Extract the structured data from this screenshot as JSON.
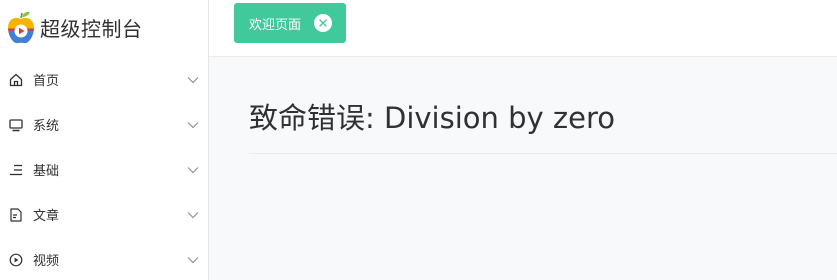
{
  "brand": {
    "title": "超级控制台",
    "logo": "apple-play-logo"
  },
  "sidebar": {
    "items": [
      {
        "label": "首页",
        "icon": "home-icon"
      },
      {
        "label": "系统",
        "icon": "monitor-icon"
      },
      {
        "label": "基础",
        "icon": "list-icon"
      },
      {
        "label": "文章",
        "icon": "document-icon"
      },
      {
        "label": "视频",
        "icon": "play-circle-icon"
      }
    ]
  },
  "tabs": [
    {
      "label": "欢迎页面",
      "active": true,
      "close_icon": "close-circle-icon"
    }
  ],
  "content": {
    "error_message": "致命错误: Division by zero"
  },
  "colors": {
    "accent": "#42c99b",
    "text": "#303133",
    "border": "#e6e6e6",
    "content_bg": "#f8f9fb"
  }
}
